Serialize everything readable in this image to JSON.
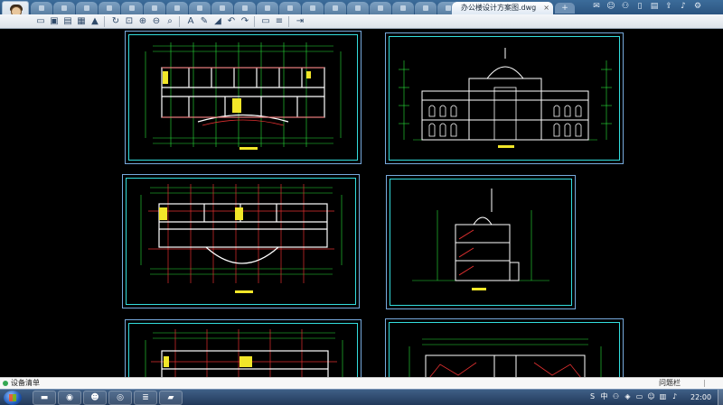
{
  "window": {
    "active_tab_title": "办公楼设计方案图.dwg",
    "tab_close": "×",
    "new_tab": "+",
    "inactive_tab_count": 19
  },
  "topbar_icons": [
    "mail-icon",
    "chat-icon",
    "user-switch-icon",
    "phone-icon",
    "clipboard-icon",
    "share-icon",
    "bell-icon",
    "settings-icon"
  ],
  "toolbar": {
    "groups": [
      [
        "open-folder-icon",
        "save-icon",
        "save-as-icon",
        "print-icon",
        "lock-icon"
      ],
      [
        "pan-icon",
        "zoom-window-icon",
        "zoom-in-icon",
        "zoom-out-icon",
        "zoom-extents-icon"
      ],
      [
        "text-icon",
        "pencil-icon",
        "brush-icon",
        "undo-icon",
        "redo-icon"
      ],
      [
        "measure-icon",
        "layers-icon"
      ],
      [
        "export-icon"
      ]
    ]
  },
  "canvas": {
    "background": "#000000",
    "sheet_border_color": "#33dddd",
    "line_colors": {
      "green": "#27e23a",
      "yellow": "#f2e629",
      "red": "#e23030",
      "white": "#ffffff",
      "cyan": "#33dddd"
    }
  },
  "status": {
    "label": "设备清单",
    "right_text": "问题栏",
    "right_more": "|",
    "status_color": "#35a853"
  },
  "taskbar": {
    "apps": [
      "folder-icon",
      "chrome-icon",
      "avatar-app-icon",
      "browser-icon",
      "stack-app-icon",
      "cad-viewer-icon"
    ],
    "tray_icons": [
      "s-app-icon",
      "ime-icon",
      "people-icon",
      "security-icon",
      "monitor-icon",
      "chat-tray-icon",
      "network-icon",
      "volume-icon"
    ],
    "time": "22:00"
  }
}
